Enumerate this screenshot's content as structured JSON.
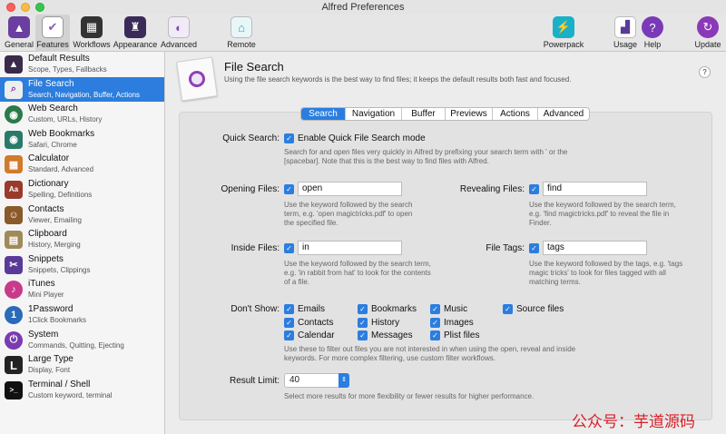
{
  "window": {
    "title": "Alfred Preferences"
  },
  "toolbar": {
    "items": [
      {
        "label": "General",
        "icon": "hat-icon",
        "color": "#6a3fa0"
      },
      {
        "label": "Features",
        "icon": "checklist-icon",
        "color": "#8a5ab8"
      },
      {
        "label": "Workflows",
        "icon": "grid-icon",
        "color": "#333333"
      },
      {
        "label": "Appearance",
        "icon": "tuxedo-icon",
        "color": "#3a2a5a"
      },
      {
        "label": "Advanced",
        "icon": "toggles-icon",
        "color": "#7a4ab0"
      },
      {
        "label": "Remote",
        "icon": "remote-icon",
        "color": "#2aa8b0"
      },
      {
        "label": "Powerpack",
        "icon": "battery-icon",
        "color": "#19b0c8"
      },
      {
        "label": "Usage",
        "icon": "chart-icon",
        "color": "#5a3a98"
      },
      {
        "label": "Help",
        "icon": "question-icon",
        "color": "#7a3ab8"
      },
      {
        "label": "Update",
        "icon": "refresh-icon",
        "color": "#8a3ab8"
      }
    ]
  },
  "sidebar": {
    "items": [
      {
        "title": "Default Results",
        "sub": "Scope, Types, Fallbacks",
        "icon": "hat-icon",
        "color": "#3a2a4a",
        "glyph": "▲"
      },
      {
        "title": "File Search",
        "sub": "Search, Navigation, Buffer, Actions",
        "icon": "file-search-icon",
        "color": "#eeeeee",
        "glyph": "⌕"
      },
      {
        "title": "Web Search",
        "sub": "Custom, URLs, History",
        "icon": "globe-icon",
        "color": "#2a7a4a",
        "glyph": "◉"
      },
      {
        "title": "Web Bookmarks",
        "sub": "Safari, Chrome",
        "icon": "bookmark-globe-icon",
        "color": "#2a7a6a",
        "glyph": "◉"
      },
      {
        "title": "Calculator",
        "sub": "Standard, Advanced",
        "icon": "calculator-icon",
        "color": "#d07a2a",
        "glyph": "▦"
      },
      {
        "title": "Dictionary",
        "sub": "Spelling, Definitions",
        "icon": "dictionary-icon",
        "color": "#9a3a2a",
        "glyph": "Aa"
      },
      {
        "title": "Contacts",
        "sub": "Viewer, Emailing",
        "icon": "contacts-icon",
        "color": "#8a5a2a",
        "glyph": "☺"
      },
      {
        "title": "Clipboard",
        "sub": "History, Merging",
        "icon": "clipboard-icon",
        "color": "#a08a5a",
        "glyph": "▤"
      },
      {
        "title": "Snippets",
        "sub": "Snippets, Clippings",
        "icon": "snippets-icon",
        "color": "#5a3a98",
        "glyph": "✂"
      },
      {
        "title": "iTunes",
        "sub": "Mini Player",
        "icon": "itunes-icon",
        "color": "#c83a8a",
        "glyph": "♪"
      },
      {
        "title": "1Password",
        "sub": "1Click Bookmarks",
        "icon": "onepassword-icon",
        "color": "#2a6ab8",
        "glyph": "1"
      },
      {
        "title": "System",
        "sub": "Commands, Quitting, Ejecting",
        "icon": "power-icon",
        "color": "#7a3ab0",
        "glyph": "⏻"
      },
      {
        "title": "Large Type",
        "sub": "Display, Font",
        "icon": "large-type-icon",
        "color": "#222222",
        "glyph": "L"
      },
      {
        "title": "Terminal / Shell",
        "sub": "Custom keyword, terminal",
        "icon": "terminal-icon",
        "color": "#111111",
        "glyph": ">_"
      }
    ]
  },
  "header": {
    "title": "File Search",
    "description": "Using the file search keywords is the best way to find files; it keeps the default results both fast and focused.",
    "help": "?"
  },
  "tabs": [
    "Search",
    "Navigation",
    "Buffer",
    "Previews",
    "Actions",
    "Advanced"
  ],
  "form": {
    "quick_search": {
      "label": "Quick Search:",
      "checkbox_label": "Enable Quick File Search mode",
      "help": "Search for and open files very quickly in Alfred by prefixing your search term with ' or the [spacebar]. Note that this is the best way to find files with Alfred."
    },
    "opening": {
      "label": "Opening Files:",
      "value": "open",
      "help": "Use the keyword followed by the search term, e.g. 'open magictricks.pdf' to open the specified file."
    },
    "revealing": {
      "label": "Revealing Files:",
      "value": "find",
      "help": "Use the keyword followed by the search term, e.g. 'find magictricks.pdf' to reveal the file in Finder."
    },
    "inside": {
      "label": "Inside Files:",
      "value": "in",
      "help": "Use the keyword followed by the search term, e.g. 'in rabbit from hat' to look for the contents of a file."
    },
    "tags": {
      "label": "File Tags:",
      "value": "tags",
      "help": "Use the keyword followed by the tags, e.g. 'tags magic tricks' to look for files tagged with all matching terms."
    },
    "dont_show": {
      "label": "Don't Show:",
      "options": [
        "Emails",
        "Contacts",
        "Calendar",
        "Bookmarks",
        "History",
        "Messages",
        "Music",
        "Images",
        "Plist files",
        "Source files"
      ],
      "help": "Use these to filter out files you are not interested in when using the open, reveal and inside keywords. For more complex filtering, use custom filter workflows."
    },
    "result_limit": {
      "label": "Result Limit:",
      "value": "40",
      "help": "Select more results for more flexibility or fewer results for higher performance."
    }
  },
  "watermark": "公众号：芋道源码"
}
